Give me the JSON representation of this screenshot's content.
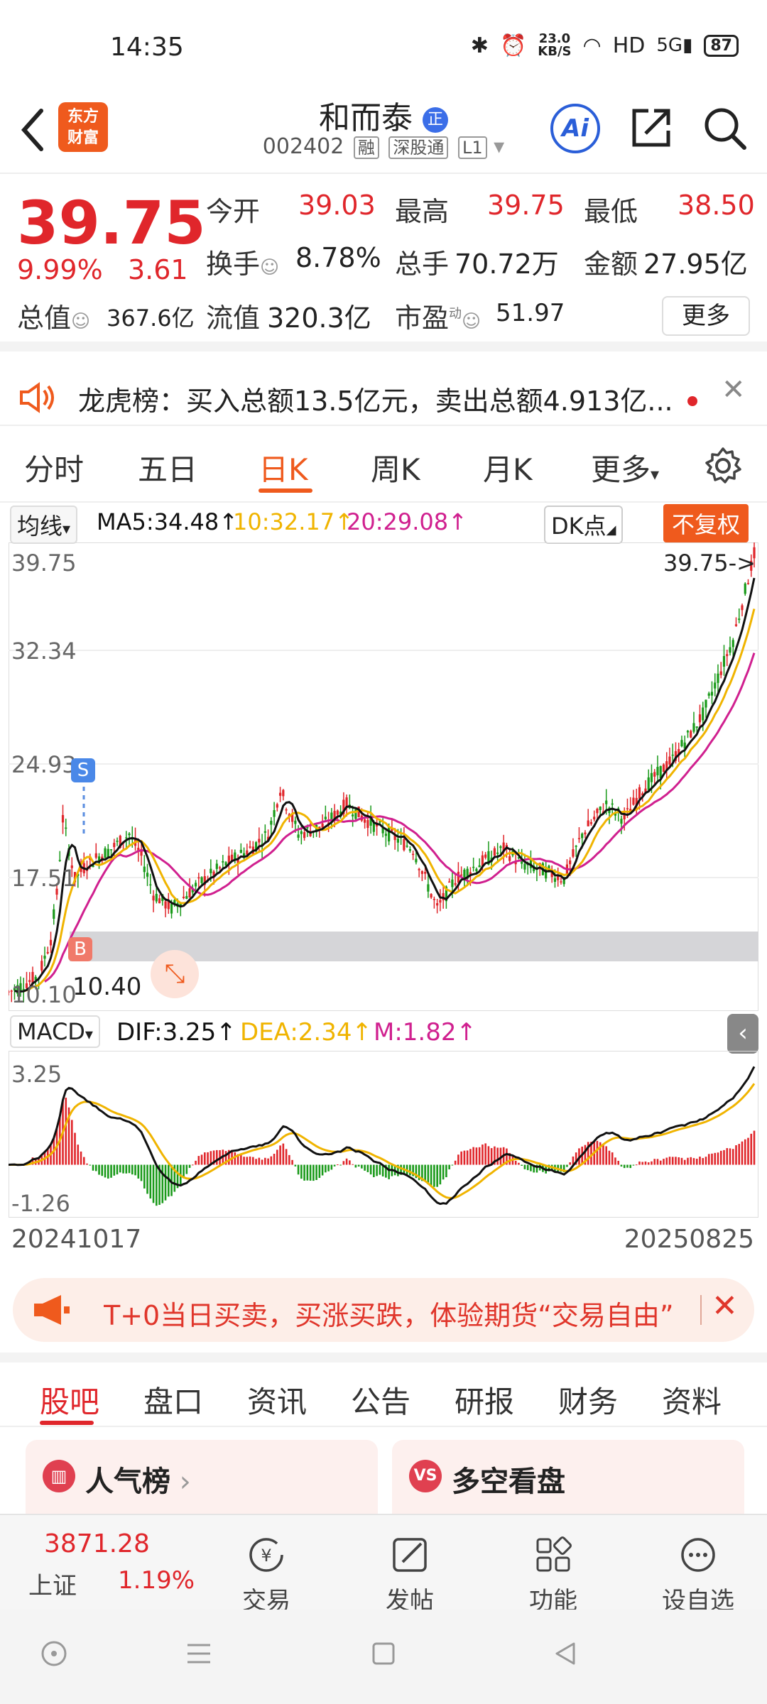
{
  "status_bar": {
    "time": "14:35",
    "net_speed": "23.0",
    "net_unit": "KB/S",
    "hd": "HD",
    "battery": "87"
  },
  "header": {
    "logo_line1": "东方",
    "logo_line2": "财富",
    "name": "和而泰",
    "name_badge": "正",
    "code": "002402",
    "tag1": "融",
    "tag2": "深股通",
    "tag3": "L1",
    "ai": "Ai"
  },
  "quote": {
    "price": "39.75",
    "change_pct": "9.99%",
    "change": "3.61",
    "open_label": "今开",
    "open": "39.03",
    "high_label": "最高",
    "high": "39.75",
    "low_label": "最低",
    "low": "38.50",
    "turnover_label": "换手",
    "turnover": "8.78%",
    "volume_label": "总手",
    "volume": "70.72万",
    "amount_label": "金额",
    "amount": "27.95亿",
    "mcap_label": "总值",
    "mcap": "367.6亿",
    "float_label": "流值",
    "float": "320.3亿",
    "pe_label": "市盈",
    "pe_sup": "动",
    "pe": "51.97",
    "more": "更多"
  },
  "notice": {
    "text": "龙虎榜：买入总额13.5亿元，卖出总额4.913亿..."
  },
  "chart_tabs": [
    "分时",
    "五日",
    "日K",
    "周K",
    "月K",
    "更多"
  ],
  "active_chart_tab": 2,
  "indicator": {
    "select": "均线",
    "ma5": "MA5:34.48↑",
    "ma10": "10:32.17↑",
    "ma20": "20:29.08↑",
    "dk": "DK点",
    "adjust": "不复权"
  },
  "colors": {
    "up": "#e0262b",
    "down": "#1a9a1a",
    "ma5": "#111111",
    "ma10": "#f0b400",
    "ma20": "#d0208f",
    "accent": "#ef5a1d"
  },
  "kline_labels": {
    "y_top": "39.75",
    "y2": "32.34",
    "y3": "24.93",
    "y4": "17.51",
    "y_low": "10.10",
    "last_price_tag": "39.75->",
    "low_mark": "10.40",
    "buy_mark": "B",
    "sell_mark": "S"
  },
  "macd_bar": {
    "select": "MACD",
    "dif": "DIF:3.25↑",
    "dea": "DEA:2.34↑",
    "m": "M:1.82↑"
  },
  "macd_labels": {
    "y_top": "3.25",
    "y_bottom": "-1.26"
  },
  "dates": {
    "start": "20241017",
    "end": "20250825"
  },
  "promo": {
    "text": "T+0当日买卖，买涨买跌，体验期货“交易自由”"
  },
  "section_tabs": [
    "股吧",
    "盘口",
    "资讯",
    "公告",
    "研报",
    "财务",
    "资料"
  ],
  "active_section_tab": 0,
  "cards": {
    "left": "人气榜",
    "right": "多空看盘"
  },
  "bottom_bar": {
    "index_value": "3871.28",
    "index_name": "上证",
    "index_pct": "1.19%",
    "items": [
      "交易",
      "发帖",
      "功能",
      "设自选"
    ]
  }
}
